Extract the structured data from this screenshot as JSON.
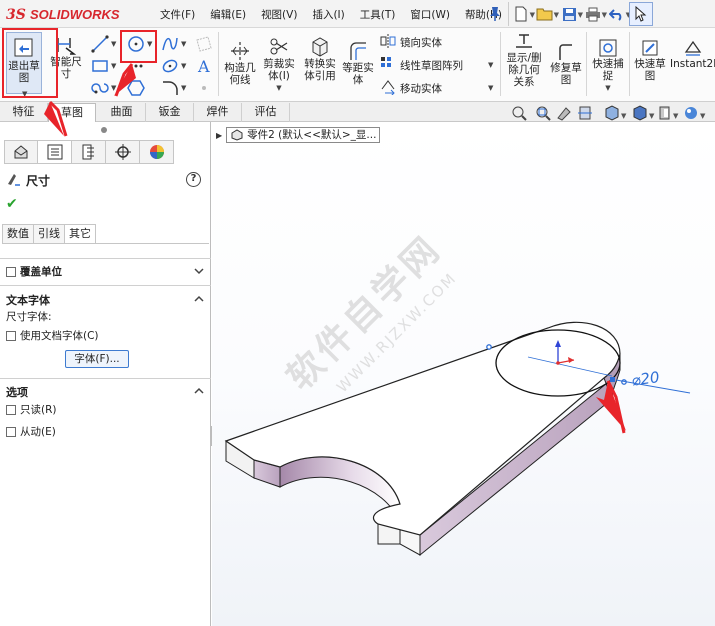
{
  "app": {
    "logo_text": "SOLIDWORKS",
    "menus": [
      "文件(F)",
      "编辑(E)",
      "视图(V)",
      "插入(I)",
      "工具(T)",
      "窗口(W)",
      "帮助(H)"
    ]
  },
  "command_manager": {
    "exit_sketch": "退出草图",
    "smart_dim_line1": "智能尺",
    "smart_dim_line2": "寸",
    "construction_line1": "构造几",
    "construction_line2": "何线",
    "trim_line1": "剪裁实",
    "trim_line2": "体(I)",
    "convert_line1": "转换实",
    "convert_line2": "体引用",
    "offset_line1": "等距实",
    "offset_line2": "体",
    "mirror": "镜向实体",
    "linear_pattern": "线性草图阵列",
    "move": "移动实体",
    "show_rel_line1": "显示/删",
    "show_rel_line2": "除几何",
    "show_rel_line3": "关系",
    "repair_line1": "修复草",
    "repair_line2": "图",
    "quick_snap_line1": "快速捕",
    "quick_snap_line2": "捉",
    "rapid_sketch_line1": "快速草",
    "rapid_sketch_line2": "图",
    "instant2d": "Instant2D"
  },
  "tabs": [
    "特征",
    "草图",
    "曲面",
    "钣金",
    "焊件",
    "评估"
  ],
  "active_tab": "草图",
  "property_manager": {
    "title": "尺寸",
    "help": "?",
    "subtabs": [
      "数值",
      "引线",
      "其它"
    ],
    "active_subtab": "其它",
    "override_units": "覆盖单位",
    "text_font_header": "文本字体",
    "dim_font_label": "尺寸字体:",
    "use_doc_font": "使用文档字体(C)",
    "font_button": "字体(F)...",
    "options_header": "选项",
    "read_only": "只读(R)",
    "driven": "从动(E)"
  },
  "graphics": {
    "tree_label": "零件2  (默认<<默认>_显...",
    "dimension_text": "⌀20",
    "watermark_cn": "软件自学网",
    "watermark_url": "WWW.RJZXW.COM"
  },
  "colors": {
    "accent_red": "#e8242a",
    "dimension_blue": "#2f6fd6",
    "face_purple": "#c7a9c9",
    "ok_green": "#29a32f"
  }
}
